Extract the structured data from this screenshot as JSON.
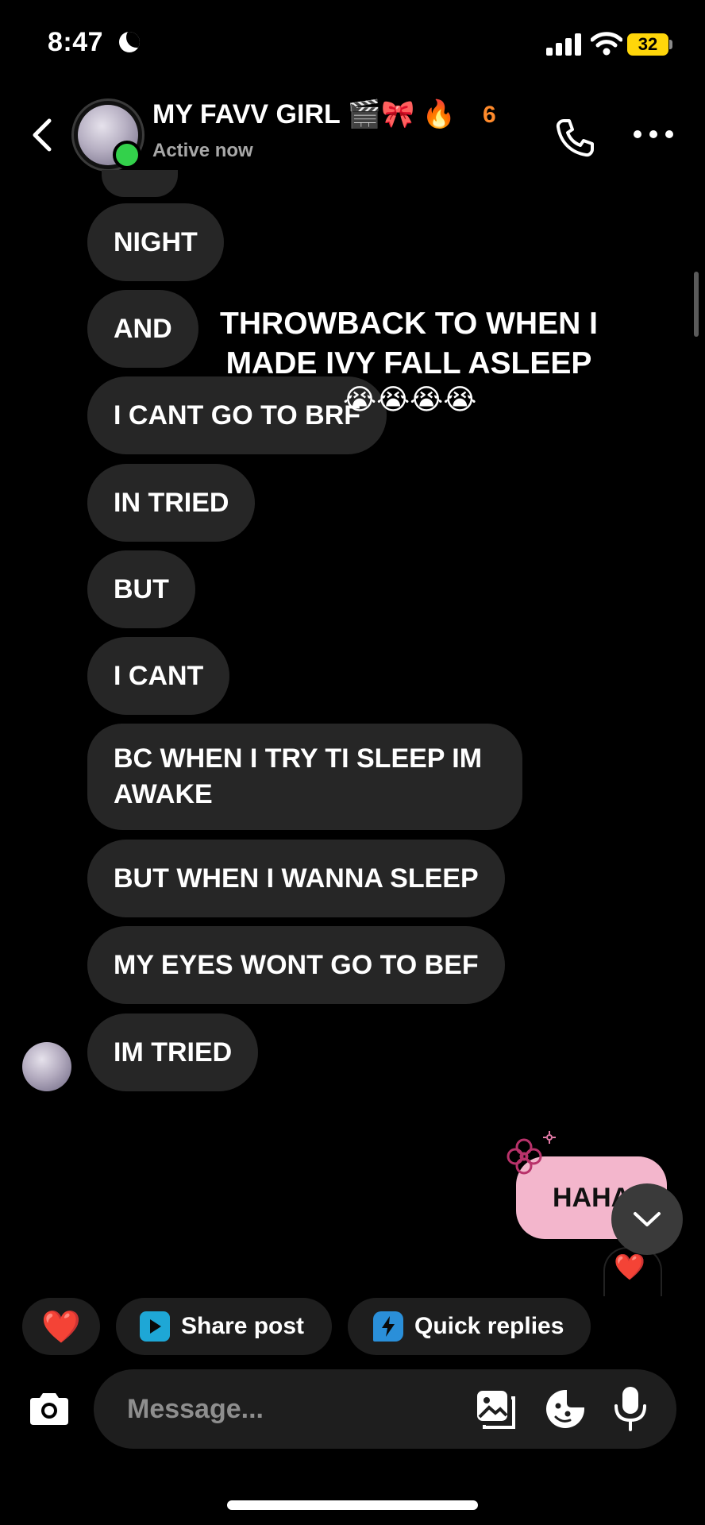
{
  "status_bar": {
    "time": "8:47",
    "battery": "32"
  },
  "header": {
    "contact_name": "MY FAVV GIRL 🎬🎀 🔥",
    "streak_count": "6",
    "status": "Active now"
  },
  "messages": [
    {
      "text": "NIGHT"
    },
    {
      "text": "AND"
    },
    {
      "text": "I CANT GO TO BRF"
    },
    {
      "text": "IN TRIED"
    },
    {
      "text": "BUT"
    },
    {
      "text": "I CANT"
    },
    {
      "text": "BC WHEN I TRY TI SLEEP IM AWAKE"
    },
    {
      "text": "BUT WHEN I WANNA SLEEP"
    },
    {
      "text": "MY EYES WONT GO TO BEF"
    },
    {
      "text": "IM TRIED"
    }
  ],
  "overlay": {
    "caption": "THROWBACK TO WHEN I MADE IVY FALL ASLEEP",
    "emojis": "😭😭😭😭"
  },
  "sent_message": {
    "text": "HAHA",
    "reaction": "❤️"
  },
  "quick_bar": {
    "heart": "❤️",
    "share_post_label": "Share post",
    "quick_replies_label": "Quick replies"
  },
  "composer": {
    "placeholder": "Message..."
  },
  "icons": {
    "back": "chevron-left-icon",
    "phone": "phone-icon",
    "more": "more-icon",
    "camera": "camera-icon",
    "gallery": "gallery-icon",
    "sticker": "sticker-icon",
    "mic": "microphone-icon",
    "scroll_down": "chevron-down-icon"
  },
  "colors": {
    "background": "#000000",
    "received_bubble": "#262626",
    "sent_bubble": "#f3b6cc",
    "online": "#33d14b",
    "streak": "#ff8a2b",
    "share_post_icon": "#1ea7d6",
    "quick_replies_icon": "#2a8fd9"
  }
}
